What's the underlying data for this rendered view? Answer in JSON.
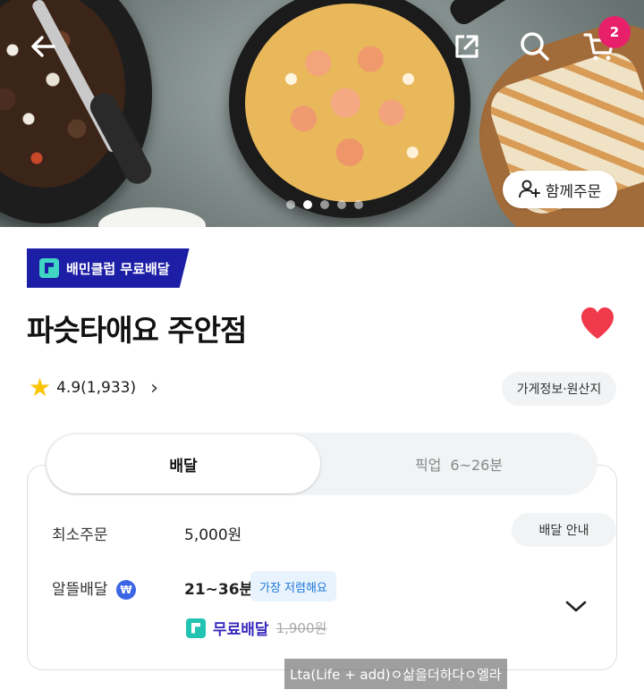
{
  "header": {
    "back_icon": "arrow-left-icon",
    "share_icon": "share-icon",
    "search_icon": "search-icon",
    "cart_icon": "cart-icon",
    "cart_badge": "2"
  },
  "hero": {
    "slide_count": 5,
    "active_slide": 2,
    "group_order_label": "함께주문"
  },
  "club_badge": "배민클럽 무료배달",
  "store": {
    "name": "파슷타애요 주안점",
    "favorited": true,
    "rating": "4.9(1,933)",
    "info_button": "가게정보·원산지"
  },
  "tabs": {
    "delivery": "배달",
    "pickup": "픽업",
    "pickup_time": "6~26분"
  },
  "details": {
    "min_order_label": "최소주문",
    "min_order_value": "5,000원",
    "delivery_guide_button": "배달 안내",
    "economy_label": "알뜰배달",
    "economy_time": "21~36분",
    "cheapest_badge": "가장 저렴해요",
    "free_delivery": "무료배달",
    "original_fee": "1,900원"
  },
  "watermark": "Lta(Life + add)ㅇ삶을더하다ㅇ엘라",
  "colors": {
    "club_badge_bg": "#1d1ea6",
    "heart": "#f0394a",
    "star": "#fbc400",
    "cart_badge": "#e8206b",
    "cheapest_text": "#1e78d8",
    "free_delivery_text": "#3a2bbd"
  }
}
